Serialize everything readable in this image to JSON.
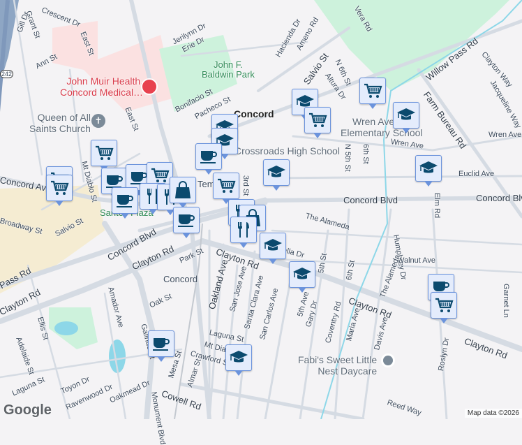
{
  "map": {
    "colors": {
      "background": "#f4f3f5",
      "road": "#d5dbe3",
      "park": "#cdf2dc",
      "hospital": "#fbe1e1",
      "commercial": "#f5ecd2",
      "water": "#8dd7e8",
      "marker_bg": "#e4ecfc",
      "marker_border": "#6b93dc",
      "icon": "#0b4a6e",
      "hospital_pin": "#e8424f"
    },
    "city_label": "Concord",
    "streets": [
      "Grant St",
      "Crescent Dr",
      "Gill Dr",
      "East St",
      "East St",
      "Ann St",
      "Jerilynn Dr",
      "Erie Dr",
      "Bonifacio St",
      "Pacheco St",
      "Hacienda Dr",
      "Ameno Rd",
      "Salvio St",
      "N 6th St",
      "Altura Dr",
      "Willow Pass Rd",
      "Farm Bureau Rd",
      "Clayton Way",
      "Jacqueline Way",
      "Wren Ave",
      "Wren Ave",
      "N 5th St",
      "6th St",
      "Euclid Ave",
      "Concord Blvd",
      "Concord Blvd",
      "Concord Ave",
      "3rd St",
      "The Alameda",
      "Humphrey Dr",
      "Elm Rd",
      "Walnut Ave",
      "Garnet Ln",
      "Clayton Rd",
      "Clayton Rd",
      "Clayton Rd",
      "5th St",
      "6th St",
      "Coventry Rd",
      "Maria Ave",
      "Davis Ave",
      "The Alameda",
      "5th Ave",
      "Gary Dr",
      "San Carlos Ave",
      "Santa Clara Ave",
      "San Jose Ave",
      "Oakland Ave",
      "Park St",
      "Concord Blvd",
      "Clayton Rd",
      "Salvio St",
      "Amador Ave",
      "Oak St",
      "Ellis St",
      "Adelaide St",
      "Laguna St",
      "Laguna St",
      "Toyon Dr",
      "Ravenwood Dr",
      "Oakmead Dr",
      "Mesa St",
      "Almar St",
      "Crawford St",
      "Cowell Rd",
      "Reed Way",
      "Roslyn Dr",
      "Mt Diablo St",
      "Galindo St",
      "Monument Blvd",
      "Pass Rd",
      "Clayton Rd",
      "Mt Diablo St",
      "Bella Dr",
      "Vera Rd",
      "Broadway St"
    ],
    "pois": {
      "hospital": "John Muir Health,\nConcord Medical…",
      "church": "Queen of All\nSaints Church",
      "park": "John F.\nBaldwin Park",
      "school1": "Wren Avenue\nElementary School",
      "school2": "Crossroads High School",
      "plaza": "Santos Plaza",
      "daycare": "Fabi's Sweet Little\nNest Daycare",
      "station": "Concord",
      "emp": "Temp",
      "highway": "242"
    },
    "markers": [
      "school",
      "cart",
      "cart",
      "school",
      "school",
      "school",
      "school",
      "school",
      "cup",
      "cart",
      "cart",
      "cart",
      "cup",
      "cup",
      "cart",
      "cup",
      "fork",
      "fork",
      "bag",
      "cup",
      "cart",
      "fork",
      "bag",
      "fork",
      "school",
      "school",
      "cup",
      "cart",
      "cup",
      "school"
    ],
    "footer": {
      "logo": "Google",
      "attribution": "Map data ©2026"
    }
  }
}
